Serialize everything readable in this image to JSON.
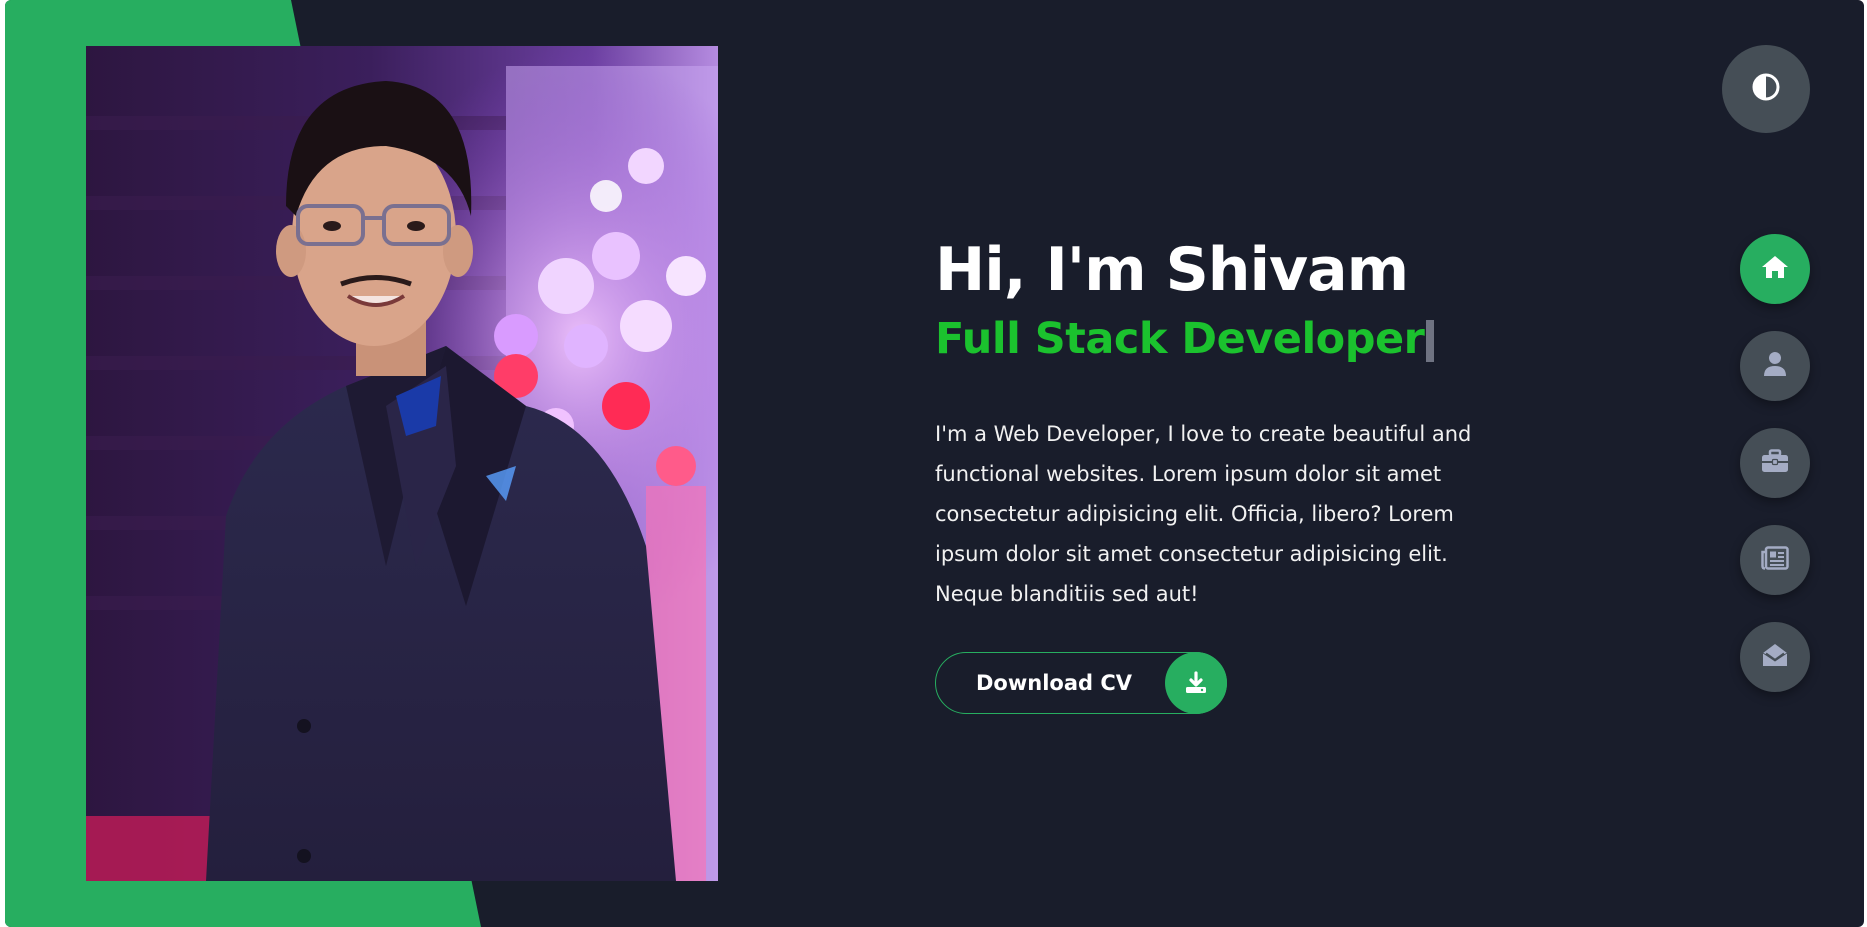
{
  "hero": {
    "greeting": "Hi, I'm Shivam",
    "role": "Full Stack Developer",
    "bio": "I'm a Web Developer, I love to create beautiful and functional websites. Lorem ipsum dolor sit amet consectetur adipisicing elit. Officia, libero? Lorem ipsum dolor sit amet consectetur adipisicing elit. Neque blanditiis sed aut!",
    "cv_button_label": "Download CV",
    "cv_icon": "download-icon"
  },
  "theme_toggle": {
    "icon": "contrast-icon"
  },
  "nav": [
    {
      "icon": "home-icon",
      "active": true
    },
    {
      "icon": "user-icon",
      "active": false
    },
    {
      "icon": "briefcase-icon",
      "active": false
    },
    {
      "icon": "newspaper-icon",
      "active": false
    },
    {
      "icon": "envelope-open-icon",
      "active": false
    }
  ],
  "colors": {
    "background": "#191d2b",
    "accent": "#27ae60",
    "role_text": "#1bc22e",
    "button_grey": "#454e56",
    "icon_grey": "#a4acc4"
  }
}
